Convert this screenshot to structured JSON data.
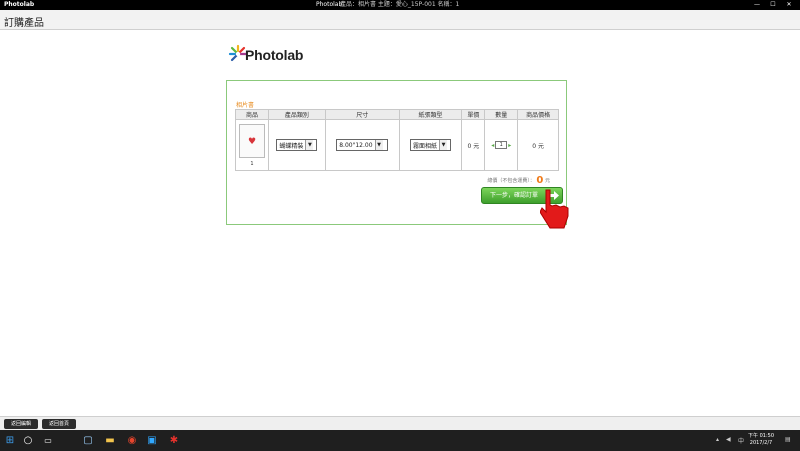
{
  "titlebar": {
    "logo": "Photolab",
    "app": "Photolab",
    "info": "產品：相片書  主題：愛心_15P-001  名稱：1",
    "min": "—",
    "max": "☐",
    "close": "✕"
  },
  "page": {
    "title": "訂購產品"
  },
  "brand": {
    "name": "Photolab"
  },
  "order": {
    "category": "相片書",
    "headers": [
      "商品",
      "產品類別",
      "尺寸",
      "紙張類型",
      "單價",
      "數量",
      "商品價格"
    ],
    "row": {
      "thumb_label": "1",
      "category": "蝴蝶精裝",
      "size": "8.00\"12.00",
      "paper": "霧面相紙",
      "unit_price": "0 元",
      "quantity": "1",
      "price": "0 元"
    },
    "total_label": "總價（不包含運費）：",
    "total_value": "0",
    "total_unit": "元",
    "next_button": "下一步，確認訂單"
  },
  "bottom": {
    "left_button": "返回編輯",
    "right_button": "返回首頁"
  },
  "taskbar": {
    "time": "下午 01:50",
    "date": "2017/2/7"
  },
  "colors": {
    "panel_border": "#8bc97b",
    "category_orange": "#e88b1e",
    "button_green": "#3e9f2c",
    "pointer_red": "#e21a1a",
    "taskbar": "#1f1f1f"
  },
  "icons": [
    "photolab-logo-icon",
    "minimize-icon",
    "maximize-icon",
    "close-icon",
    "heart-icon",
    "select-caret-icon",
    "arrow-right-icon",
    "hand-pointer-icon",
    "windows-start-icon",
    "search-icon",
    "task-view-icon",
    "app-icon",
    "folder-icon",
    "chrome-icon",
    "photoshop-icon",
    "photolab-app-icon",
    "network-icon",
    "volume-icon",
    "notification-icon"
  ]
}
